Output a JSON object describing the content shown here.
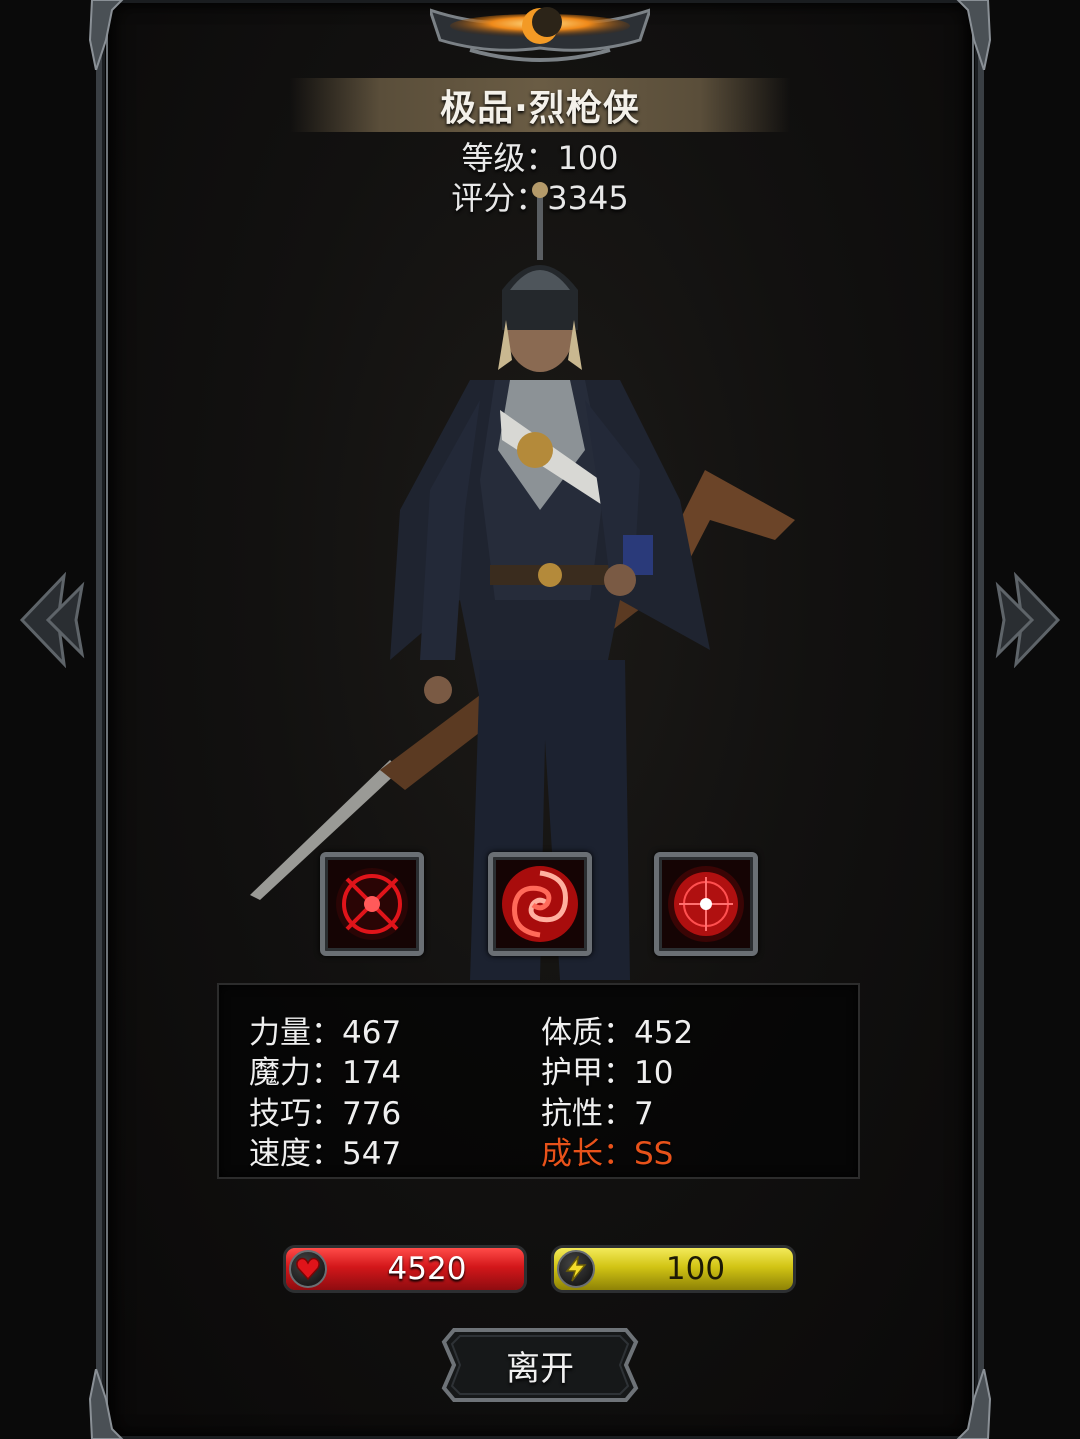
{
  "header": {
    "title": "极品·烈枪侠",
    "level_label": "等级：100",
    "score_label": "评分：3345"
  },
  "skills": [
    {
      "icon": "crosshair-ring-icon"
    },
    {
      "icon": "swirl-vortex-icon"
    },
    {
      "icon": "target-orb-icon"
    }
  ],
  "stats": {
    "strength": "力量：467",
    "constitution": "体质：452",
    "magic": "魔力：174",
    "armor": "护甲：10",
    "skill": "技巧：776",
    "resistance": "抗性：7",
    "speed": "速度：547",
    "growth": "成长：SS"
  },
  "bars": {
    "hp": {
      "value": "4520",
      "icon": "heart-icon",
      "fill_percent": 100
    },
    "energy": {
      "value": "100",
      "icon": "lightning-icon",
      "fill_percent": 100
    }
  },
  "leave_button": {
    "label": "离开"
  },
  "colors": {
    "growth_highlight": "#e8521a",
    "hp_bar": "#d3171a",
    "energy_bar": "#d2c414",
    "title_banner": "#5a4e3a"
  }
}
